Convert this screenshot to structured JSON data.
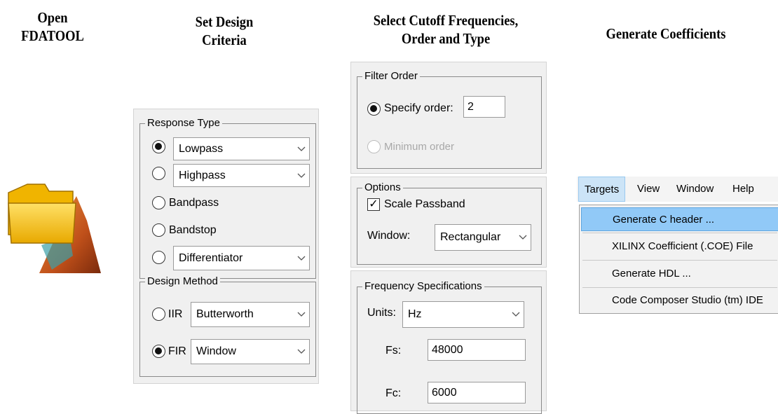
{
  "headings": {
    "step1": "Open\nFDATOOL",
    "step2": "Set Design\nCriteria",
    "step3": "Select Cutoff Frequencies,\nOrder and Type",
    "step4": "Generate Coefficients"
  },
  "icon": {
    "name": "folder-matlab-icon",
    "colors": {
      "folder": "#f6c21a",
      "membrane": "#c0501a"
    }
  },
  "design_panel": {
    "response_type": {
      "title": "Response Type",
      "options": [
        {
          "label": "Lowpass",
          "selected": true,
          "dropdown": true
        },
        {
          "label": "Highpass",
          "selected": false,
          "dropdown": true
        },
        {
          "label": "Bandpass",
          "selected": false,
          "dropdown": false
        },
        {
          "label": "Bandstop",
          "selected": false,
          "dropdown": false
        },
        {
          "label": "Differentiator",
          "selected": false,
          "dropdown": true
        }
      ]
    },
    "design_method": {
      "title": "Design Method",
      "iir_label": "IIR",
      "iir_value": "Butterworth",
      "fir_label": "FIR",
      "fir_value": "Window",
      "selected": "FIR"
    }
  },
  "filter_order": {
    "title": "Filter Order",
    "specify_label": "Specify order:",
    "order_value": "2",
    "minimum_label": "Minimum order"
  },
  "options": {
    "title": "Options",
    "scale_passband_label": "Scale Passband",
    "scale_passband_checked": true,
    "window_label": "Window:",
    "window_value": "Rectangular"
  },
  "frequency_specs": {
    "title": "Frequency Specifications",
    "units_label": "Units:",
    "units_value": "Hz",
    "fs_label": "Fs:",
    "fs_value": "48000",
    "fc_label": "Fc:",
    "fc_value": "6000"
  },
  "menu": {
    "bar": [
      "Targets",
      "View",
      "Window",
      "Help"
    ],
    "items": [
      "Generate C header ...",
      "XILINX Coefficient (.COE) File",
      "Generate HDL ...",
      "Code Composer Studio (tm) IDE"
    ]
  }
}
